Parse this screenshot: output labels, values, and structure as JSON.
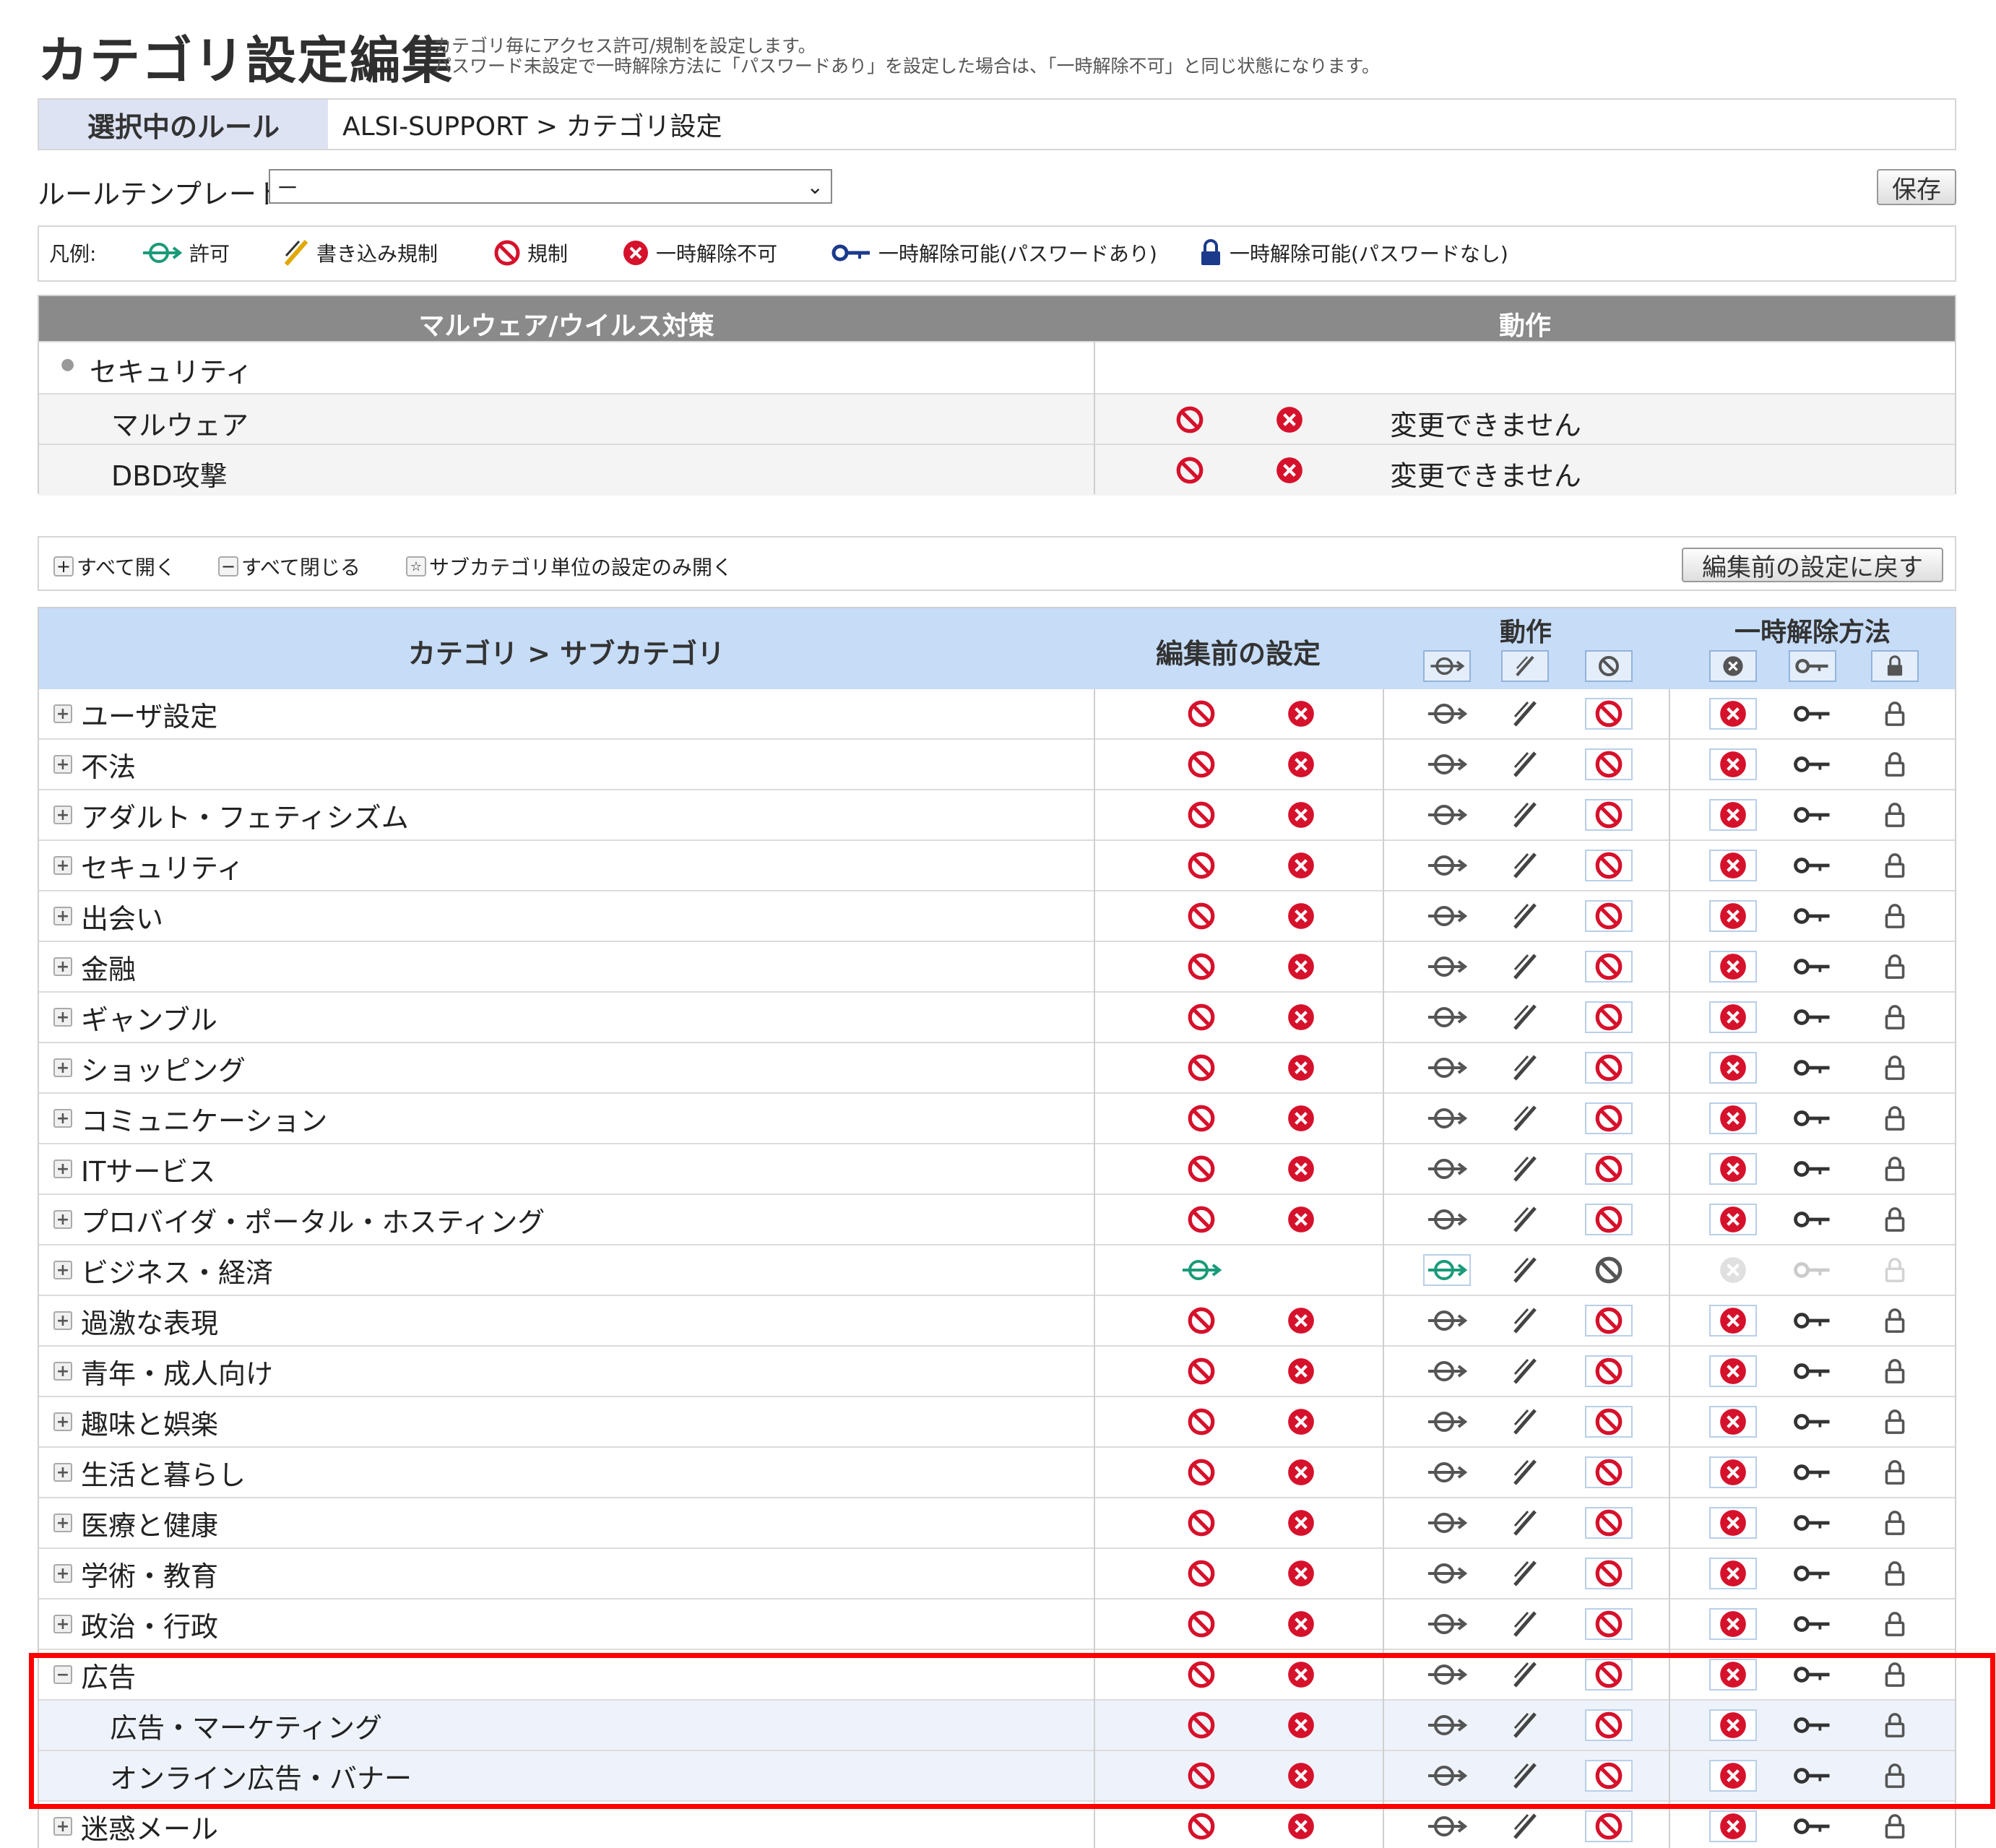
{
  "header": {
    "title": "カテゴリ設定編集",
    "desc_line1": "カテゴリ毎にアクセス許可/規制を設定します。",
    "desc_line2": "パスワード未設定で一時解除方法に「パスワードあり」を設定した場合は、「一時解除不可」と同じ状態になります。"
  },
  "rule": {
    "label": "選択中のルール",
    "value": "ALSI-SUPPORT > カテゴリ設定"
  },
  "template": {
    "label": "ルールテンプレート:",
    "selected": "－"
  },
  "save_label": "保存",
  "legend": {
    "label": "凡例:",
    "items": [
      {
        "icon": "allow-icon",
        "label": "許可"
      },
      {
        "icon": "write-restrict-icon",
        "label": "書き込み規制"
      },
      {
        "icon": "block-icon",
        "label": "規制"
      },
      {
        "icon": "no-override-icon",
        "label": "一時解除不可"
      },
      {
        "icon": "key-icon",
        "label": "一時解除可能(パスワードあり)"
      },
      {
        "icon": "lock-icon",
        "label": "一時解除可能(パスワードなし)"
      }
    ]
  },
  "malware": {
    "col_category": "マルウェア/ウイルス対策",
    "col_action": "動作",
    "section": "セキュリティ",
    "rows": [
      {
        "name": "マルウェア",
        "note": "変更できません"
      },
      {
        "name": "DBD攻撃",
        "note": "変更できません"
      }
    ]
  },
  "toolbar": {
    "expand_all": "すべて開く",
    "collapse_all": "すべて閉じる",
    "subcat_only": "サブカテゴリ単位の設定のみ開く",
    "revert": "編集前の設定に戻す"
  },
  "category_table": {
    "col_category": "カテゴリ > サブカテゴリ",
    "col_before": "編集前の設定",
    "col_action": "動作",
    "col_override": "一時解除方法",
    "rows": [
      {
        "name": "ユーザ設定",
        "state": "block",
        "expander": "+"
      },
      {
        "name": "不法",
        "state": "block",
        "expander": "+"
      },
      {
        "name": "アダルト・フェティシズム",
        "state": "block",
        "expander": "+"
      },
      {
        "name": "セキュリティ",
        "state": "block",
        "expander": "+"
      },
      {
        "name": "出会い",
        "state": "block",
        "expander": "+"
      },
      {
        "name": "金融",
        "state": "block",
        "expander": "+"
      },
      {
        "name": "ギャンブル",
        "state": "block",
        "expander": "+"
      },
      {
        "name": "ショッピング",
        "state": "block",
        "expander": "+"
      },
      {
        "name": "コミュニケーション",
        "state": "block",
        "expander": "+"
      },
      {
        "name": "ITサービス",
        "state": "block",
        "expander": "+"
      },
      {
        "name": "プロバイダ・ポータル・ホスティング",
        "state": "block",
        "expander": "+"
      },
      {
        "name": "ビジネス・経済",
        "state": "allow",
        "expander": "+"
      },
      {
        "name": "過激な表現",
        "state": "block",
        "expander": "+"
      },
      {
        "name": "青年・成人向け",
        "state": "block",
        "expander": "+"
      },
      {
        "name": "趣味と娯楽",
        "state": "block",
        "expander": "+"
      },
      {
        "name": "生活と暮らし",
        "state": "block",
        "expander": "+"
      },
      {
        "name": "医療と健康",
        "state": "block",
        "expander": "+"
      },
      {
        "name": "学術・教育",
        "state": "block",
        "expander": "+"
      },
      {
        "name": "政治・行政",
        "state": "block",
        "expander": "+"
      },
      {
        "name": "広告",
        "state": "block",
        "expander": "−"
      },
      {
        "name": "広告・マーケティング",
        "state": "block",
        "sub": true
      },
      {
        "name": "オンライン広告・バナー",
        "state": "block",
        "sub": true
      },
      {
        "name": "迷惑メール",
        "state": "block",
        "expander": "+"
      }
    ]
  },
  "colors": {
    "block": "#d6112b",
    "allow": "#1a9a79",
    "header_bg": "#c6dcf7",
    "highlight": "#ff0000"
  }
}
